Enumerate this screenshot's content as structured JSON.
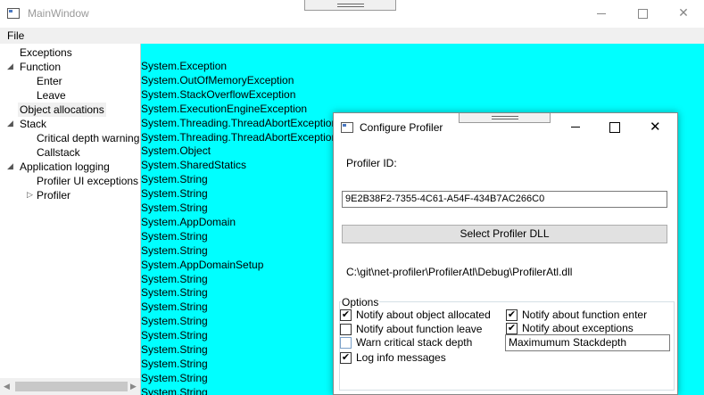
{
  "window": {
    "title": "MainWindow",
    "close_glyph": "✕",
    "menu": {
      "file_label": "File"
    }
  },
  "tree": {
    "items": [
      {
        "label": "Exceptions"
      },
      {
        "label": "Function",
        "arrow": "◢"
      },
      {
        "label": "Enter"
      },
      {
        "label": "Leave"
      },
      {
        "label": "Object allocations",
        "selected": true
      },
      {
        "label": "Stack",
        "arrow": "◢"
      },
      {
        "label": "Critical depth warning"
      },
      {
        "label": "Callstack"
      },
      {
        "label": "Application logging",
        "arrow": "◢"
      },
      {
        "label": "Profiler UI exceptions"
      },
      {
        "label": "Profiler",
        "arrow": "▷"
      }
    ],
    "scroll_left": "◀",
    "scroll_right": "▶"
  },
  "content": {
    "background": "#00ffff",
    "lines": [
      "System.Exception",
      "System.OutOfMemoryException",
      "System.StackOverflowException",
      "System.ExecutionEngineException",
      "System.Threading.ThreadAbortException",
      "System.Threading.ThreadAbortException",
      "System.Object",
      "System.SharedStatics",
      "System.String",
      "System.String",
      "System.String",
      "System.AppDomain",
      "System.String",
      "System.String",
      "System.AppDomainSetup",
      "System.String",
      "System.String",
      "System.String",
      "System.String",
      "System.String",
      "System.String",
      "System.String",
      "System.String",
      "System.String"
    ]
  },
  "dialog": {
    "title": "Configure Profiler",
    "close_glyph": "✕",
    "profiler_id_label": "Profiler ID:",
    "profiler_id_value": "9E2B38F2-7355-4C61-A54F-434B7AC266C0",
    "select_button": "Select Profiler DLL",
    "dll_path": "C:\\git\\net-profiler\\ProfilerAtl\\Debug\\ProfilerAtl.dll",
    "options_label": "Options",
    "checkboxes": [
      {
        "label": "Notify about object allocated",
        "checked": true
      },
      {
        "label": "Notify about function leave",
        "checked": false
      },
      {
        "label": "Warn critical stack depth",
        "checked": false
      },
      {
        "label": "Log info messages",
        "checked": true
      },
      {
        "label": "Notify about function enter",
        "checked": true
      },
      {
        "label": "Notify about exceptions",
        "checked": true
      }
    ],
    "check_glyph": "✔",
    "stackdepth_value": "Maximumum Stackdepth"
  }
}
